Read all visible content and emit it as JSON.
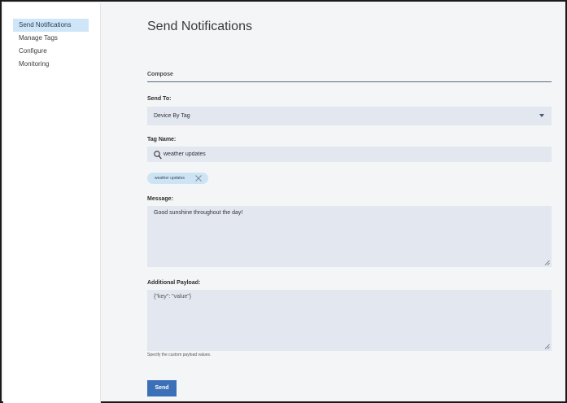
{
  "sidebar": {
    "items": [
      {
        "label": "Send Notifications",
        "active": true
      },
      {
        "label": "Manage Tags",
        "active": false
      },
      {
        "label": "Configure",
        "active": false
      },
      {
        "label": "Monitoring",
        "active": false
      }
    ]
  },
  "main": {
    "title": "Send Notifications",
    "section_label": "Compose",
    "send_to": {
      "label": "Send To:",
      "value": "Device By Tag"
    },
    "tag_name": {
      "label": "Tag Name:",
      "value": "weather updates"
    },
    "selected_tags": [
      "weather updates"
    ],
    "message": {
      "label": "Message:",
      "value": "Good sunshine throughout the day!"
    },
    "payload": {
      "label": "Additional Payload:",
      "value": "{\"key\": \"value\"}",
      "helper": "Specify the custom payload values."
    },
    "send_label": "Send"
  },
  "icons": {
    "search": "search-icon",
    "chip_close": "close-icon",
    "select_caret": "caret-down-icon",
    "resize": "resize-grip-icon"
  },
  "colors": {
    "accent": "#3b70b8",
    "active_nav": "#cfe6f8",
    "field_bg": "#e2e7f0",
    "chip_bg": "#cde4f5"
  }
}
